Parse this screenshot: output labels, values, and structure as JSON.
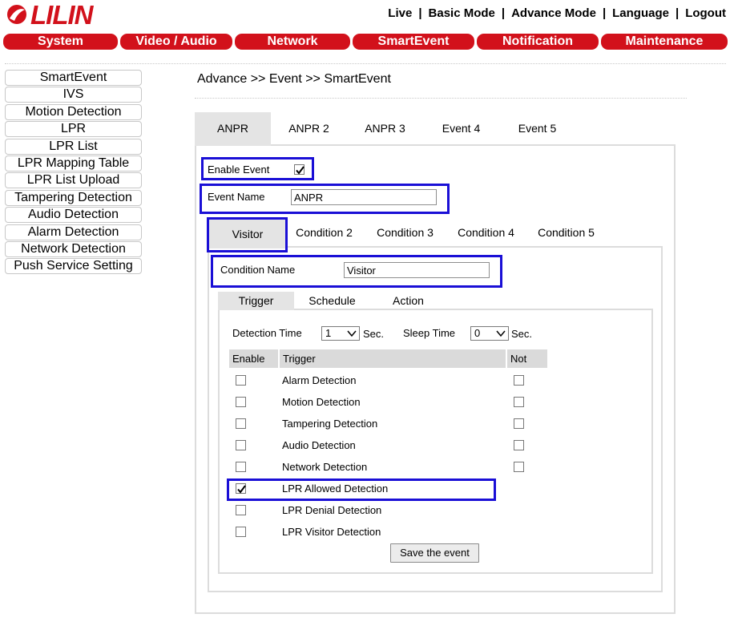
{
  "brand": {
    "logo_text": "LILIN",
    "logo_color": "#d2111b"
  },
  "topnav": {
    "live": "Live",
    "basic": "Basic Mode",
    "advance": "Advance Mode",
    "language": "Language",
    "logout": "Logout",
    "separator": "|"
  },
  "mainmenu": [
    "System",
    "Video / Audio",
    "Network",
    "SmartEvent",
    "Notification",
    "Maintenance"
  ],
  "sidemenu": [
    "SmartEvent",
    "IVS",
    "Motion Detection",
    "LPR",
    "LPR List",
    "LPR Mapping Table",
    "LPR List Upload",
    "Tampering Detection",
    "Audio Detection",
    "Alarm Detection",
    "Network Detection",
    "Push Service Setting"
  ],
  "breadcrumb": "Advance >> Event >> SmartEvent",
  "event_tabs": [
    "ANPR",
    "ANPR 2",
    "ANPR 3",
    "Event 4",
    "Event 5"
  ],
  "enable_event": {
    "label": "Enable Event",
    "checked": true
  },
  "event_name": {
    "label": "Event Name",
    "value": "ANPR"
  },
  "condition_tabs": [
    "Visitor",
    "Condition 2",
    "Condition 3",
    "Condition 4",
    "Condition 5"
  ],
  "condition_name": {
    "label": "Condition Name",
    "value": "Visitor"
  },
  "sub_tabs": [
    "Trigger",
    "Schedule",
    "Action"
  ],
  "detection_time": {
    "label": "Detection Time",
    "value": "1",
    "unit": "Sec."
  },
  "sleep_time": {
    "label": "Sleep Time",
    "value": "0",
    "unit": "Sec."
  },
  "table_headers": {
    "enable": "Enable",
    "trigger": "Trigger",
    "not": "Not"
  },
  "triggers": [
    {
      "name": "Alarm Detection",
      "enabled": false,
      "not_box": true
    },
    {
      "name": "Motion Detection",
      "enabled": false,
      "not_box": true
    },
    {
      "name": "Tampering Detection",
      "enabled": false,
      "not_box": true
    },
    {
      "name": "Audio Detection",
      "enabled": false,
      "not_box": true
    },
    {
      "name": "Network Detection",
      "enabled": false,
      "not_box": true
    },
    {
      "name": "LPR Allowed Detection",
      "enabled": true,
      "not_box": false
    },
    {
      "name": "LPR Denial Detection",
      "enabled": false,
      "not_box": false
    },
    {
      "name": "LPR Visitor Detection",
      "enabled": false,
      "not_box": false
    }
  ],
  "save_button": "Save the event",
  "colors": {
    "menu": "#d2111b",
    "highlight": "#1a0fd6",
    "tab_active": "#e4e4e4"
  }
}
